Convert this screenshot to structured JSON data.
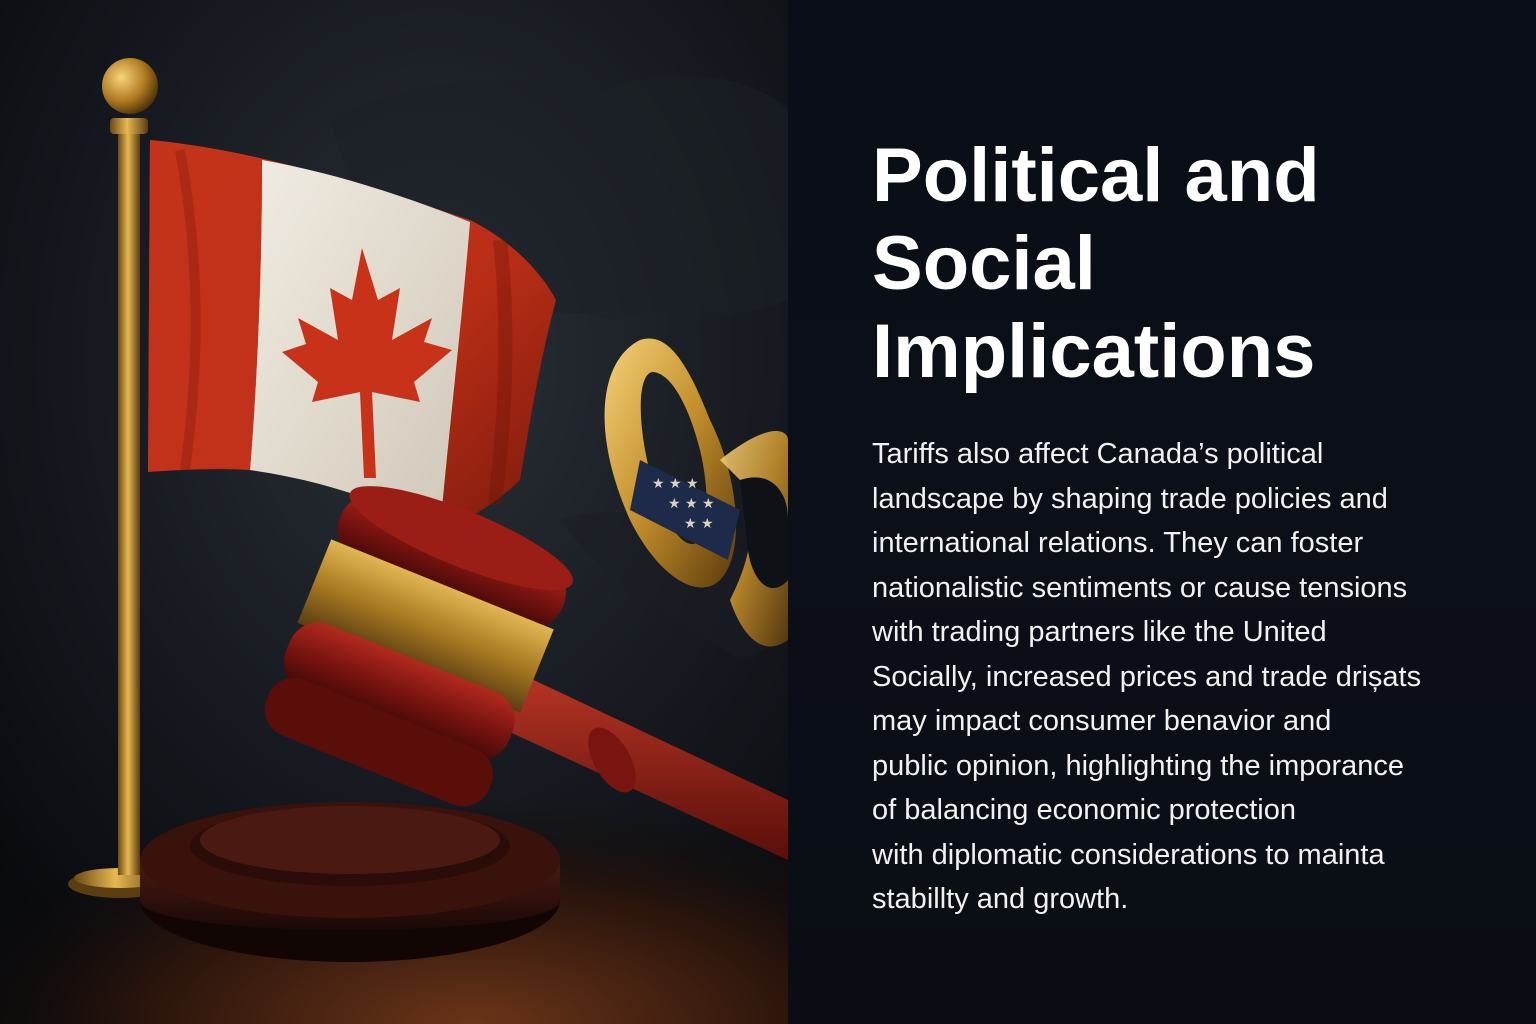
{
  "title_lines": [
    "Political and",
    "Social",
    "Implications"
  ],
  "body_lines": [
    "Tariffs also affect Canada’s political",
    "landscape by shaping trade policies and",
    "international relations. They can foster",
    "nationalistic sentiments or cause tensions",
    "with trading partners like the United",
    "Socially, increased prices and trade drișats",
    "may impact consumer benavior and",
    "public opinion, highlighting the imporance",
    "of balancing economic protection",
    "with diplomatic considerations to mainta",
    "stabillty and growth."
  ],
  "colors": {
    "background": "#0b0e14",
    "flag_red": "#c8321c",
    "flag_white": "#ece7dc",
    "gavel_red": "#7a1410",
    "gold": "#c9962a",
    "text": "#ffffff"
  },
  "illustration": {
    "flag_icon": "canada-flag",
    "gavel_icon": "gavel",
    "chain_icon": "chain-link"
  }
}
